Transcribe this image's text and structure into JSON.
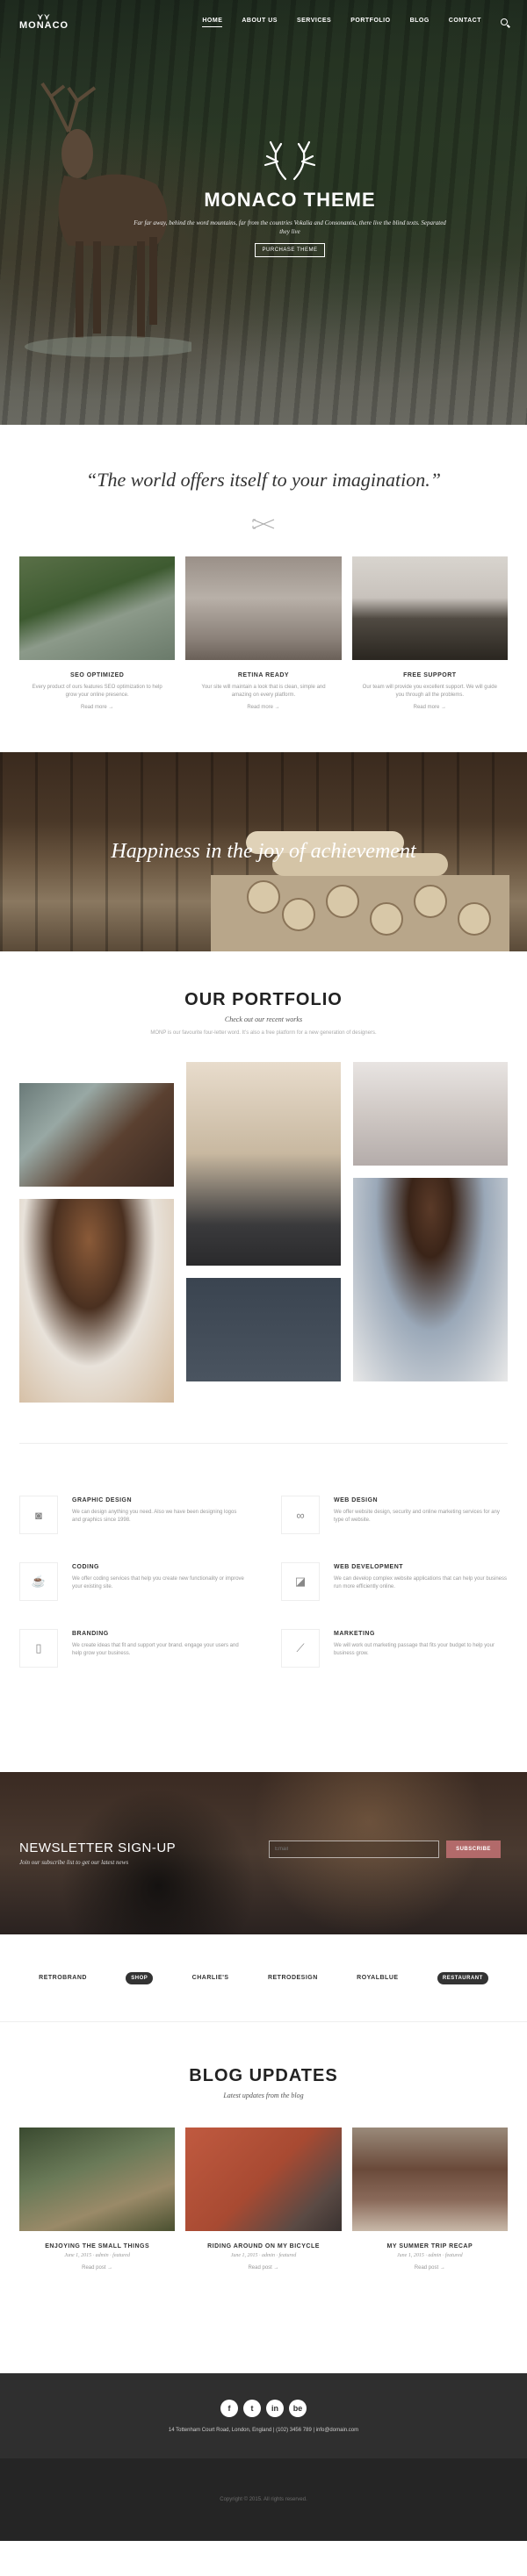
{
  "header": {
    "logo": "MONACO",
    "nav": [
      "HOME",
      "ABOUT US",
      "SERVICES",
      "PORTFOLIO",
      "BLOG",
      "CONTACT"
    ]
  },
  "hero": {
    "title": "MONACO THEME",
    "subtitle": "Far far away, behind the word mountains, far from the countries Vokalia and Consonantia, there live the blind texts. Separated they live",
    "button": "PURCHASE THEME"
  },
  "quote": "“The world offers itself to your imagination.”",
  "features": [
    {
      "title": "SEO OPTIMIZED",
      "text": "Every product of ours features SEO optimization to help grow your online presence.",
      "more": "Read more →"
    },
    {
      "title": "RETINA READY",
      "text": "Your site will maintain a look that is clean, simple and amazing on every platform.",
      "more": "Read more →"
    },
    {
      "title": "FREE SUPPORT",
      "text": "Our team will provide you excellent support. We will guide you through all the problems.",
      "more": "Read more →"
    }
  ],
  "wood_banner": "Happiness in the joy of achievement",
  "portfolio": {
    "title": "OUR PORTFOLIO",
    "subtitle": "Check out our recent works",
    "description": "MONP is our favourite four-letter word. It’s also a free platform for a new generation of designers."
  },
  "services": [
    {
      "title": "GRAPHIC DESIGN",
      "text": "We can design anything you need. Also we have been designing logos and graphics since 1998.",
      "icon": "camera-icon"
    },
    {
      "title": "WEB DESIGN",
      "text": "We offer website design, security and online marketing services for any type of website.",
      "icon": "bicycle-icon"
    },
    {
      "title": "CODING",
      "text": "We offer coding services that help you create new functionality or improve your existing site.",
      "icon": "coffee-cup-icon"
    },
    {
      "title": "WEB DEVELOPMENT",
      "text": "We can develop complex website applications that can help your business run more efficiently online.",
      "icon": "chart-icon"
    },
    {
      "title": "BRANDING",
      "text": "We create ideas that fit and support your brand. engage your users and help grow your business.",
      "icon": "mouse-icon"
    },
    {
      "title": "MARKETING",
      "text": "We will work out marketing passage that fits your budget to help your business grow.",
      "icon": "line-chart-icon"
    }
  ],
  "newsletter": {
    "title": "NEWSLETTER SIGN-UP",
    "subtitle": "Join our subscribe list to get our latest news",
    "placeholder": "Email",
    "button": "SUBSCRIBE"
  },
  "clients": [
    "RETROBRAND",
    "SHOP",
    "CHARLIE'S",
    "RETRODESIGN",
    "ROYALBLUE",
    "RESTAURANT"
  ],
  "blog": {
    "title": "BLOG UPDATES",
    "subtitle": "Latest updates from the blog",
    "posts": [
      {
        "title": "ENJOYING THE SMALL THINGS",
        "meta": "June 1, 2015 · admin · featured",
        "more": "Read post →"
      },
      {
        "title": "RIDING AROUND ON MY BICYCLE",
        "meta": "June 1, 2015 · admin · featured",
        "more": "Read post →"
      },
      {
        "title": "MY SUMMER TRIP RECAP",
        "meta": "June 1, 2015 · admin · featured",
        "more": "Read post →"
      }
    ]
  },
  "footer": {
    "socials": [
      "f",
      "t",
      "in",
      "be"
    ],
    "address": "14 Tottenham Court Road, London, England | (102) 3456 789 | info@domain.com",
    "copyright": "Copyright © 2015. All rights reserved."
  }
}
